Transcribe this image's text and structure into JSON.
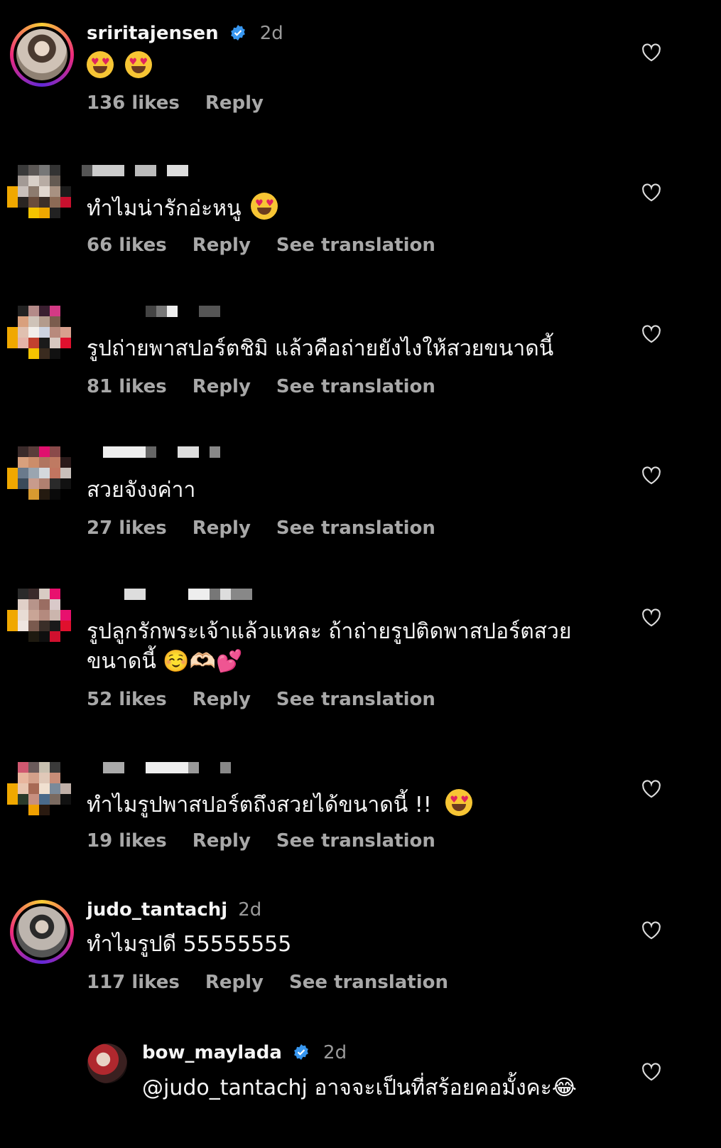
{
  "comments": [
    {
      "username": "sriritajensen",
      "verified": true,
      "time": "2d",
      "text": "",
      "emojis": [
        "😍",
        "😍"
      ],
      "likes": "136 likes",
      "reply": "Reply",
      "translation": ""
    },
    {
      "username": "",
      "verified": false,
      "time": "",
      "text": "ทำไมน่ารักอ่ะหนู",
      "emojis": [
        "😍"
      ],
      "likes": "66 likes",
      "reply": "Reply",
      "translation": "See translation"
    },
    {
      "username": "",
      "verified": false,
      "time": "",
      "text": "รูปถ่ายพาสปอร์ตชิมิ แล้วคือถ่ายยังไงให้สวยขนาดนี้",
      "emojis": [],
      "likes": "81 likes",
      "reply": "Reply",
      "translation": "See translation"
    },
    {
      "username": "",
      "verified": false,
      "time": "",
      "text": "สวยจังงค่าา",
      "emojis": [],
      "likes": "27 likes",
      "reply": "Reply",
      "translation": "See translation"
    },
    {
      "username": "",
      "verified": false,
      "time": "",
      "text": "รูปลูกรักพระเจ้าแล้วแหละ ถ้าถ่ายรูปติดพาสปอร์ตสวย",
      "text2": "ขนาดนี้ ☺️🫶🏻💕",
      "emojis": [],
      "likes": "52 likes",
      "reply": "Reply",
      "translation": "See translation"
    },
    {
      "username": "",
      "verified": false,
      "time": "",
      "text": "ทำไมรูปพาสปอร์ตถึงสวยได้ขนาดนี้ !!",
      "emojis": [
        "😍"
      ],
      "likes": "19 likes",
      "reply": "Reply",
      "translation": "See translation"
    },
    {
      "username": "judo_tantachj",
      "verified": false,
      "time": "2d",
      "text": "ทำไมรูปดี 55555555",
      "emojis": [],
      "likes": "117 likes",
      "reply": "Reply",
      "translation": "See translation"
    },
    {
      "username": "bow_maylada",
      "verified": true,
      "time": "2d",
      "text": "@judo_tantachj อาจจะเป็นที่สร้อยคอมั้งคะ😂",
      "emojis": [],
      "likes": "",
      "reply": "",
      "translation": ""
    }
  ]
}
